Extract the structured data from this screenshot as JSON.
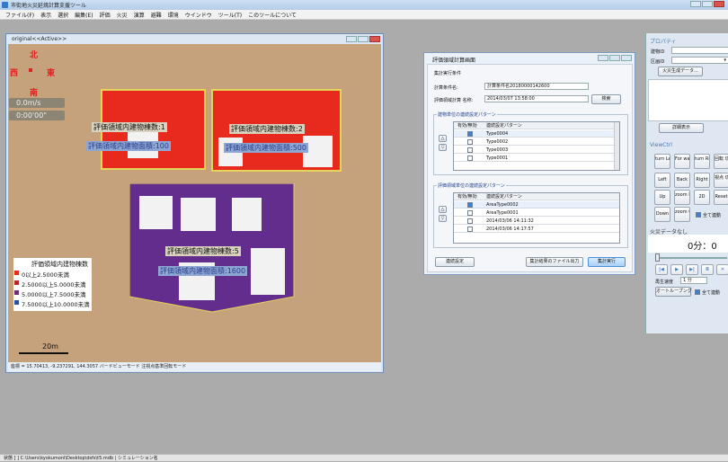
{
  "app": {
    "title": "市街地火災延焼計算支援ツール"
  },
  "menu": [
    "ファイル(F)",
    "表示",
    "選択",
    "編集(E)",
    "評価",
    "火災",
    "演算",
    "避難",
    "環境",
    "ウインドウ",
    "ツール(T)",
    "このツールについて"
  ],
  "original": {
    "title": "original<<Active>>",
    "hud": {
      "north": "北",
      "west": "西",
      "east": "東",
      "south": "南",
      "wind": "0.0m/s",
      "time": "0:00'00\""
    },
    "areas": [
      {
        "count_label": "評価領域内建物棟数:1",
        "area_label": "評価領域内建物面積:100"
      },
      {
        "count_label": "評価領域内建物棟数:2",
        "area_label": "評価領域内建物面積:500"
      },
      {
        "count_label": "評価領域内建物棟数:5",
        "area_label": "評価領域内建物面積:1600"
      }
    ],
    "legend": {
      "title": "評価領域内建物棟数",
      "items": [
        {
          "label": "0以上2.5000未満",
          "color": "#e82a1e"
        },
        {
          "label": "2.5000以上5.0000未満",
          "color": "#b8262b"
        },
        {
          "label": "5.0000以上7.5000未満",
          "color": "#6a2a7e"
        },
        {
          "label": "7.5000以上10.0000未満",
          "color": "#2453a6"
        }
      ]
    },
    "scale": "20m",
    "status": "座標 = 15.70413, -9.237291, 144.3057  バードビューモード  注視点基準回転モード"
  },
  "dialog": {
    "title": "評価領域計算画面",
    "section": "集計実行条件",
    "cond_label": "計算条件名:",
    "cond_value": "計算条件名20180000142600",
    "result_label": "評価領域計算 名称:",
    "result_value": "2014/03/07 13:58:00",
    "search_btn": "検索",
    "group1": {
      "title": "建物単位の連続設定パターン",
      "col1": "有効/無効",
      "col2": "連続設定パターン",
      "rows": [
        {
          "on": true,
          "name": "Type0004"
        },
        {
          "on": false,
          "name": "Type0002"
        },
        {
          "on": false,
          "name": "Type0003"
        },
        {
          "on": false,
          "name": "Type0001"
        }
      ]
    },
    "group2": {
      "title": "評価領域単位の連続設定パターン",
      "col1": "有効/無効",
      "col2": "連続設定パターン",
      "rows": [
        {
          "on": true,
          "name": "AreaType0002"
        },
        {
          "on": false,
          "name": "AreaType0001"
        },
        {
          "on": false,
          "name": "2014/03/06 14:11:32"
        },
        {
          "on": false,
          "name": "2014/03/06 14:17:57"
        }
      ]
    },
    "btn_detail": "連続設定",
    "btn_export": "集計結果のファイル出力",
    "btn_run": "集計実行"
  },
  "right": {
    "props_title": "プロパティ",
    "prop1": "建物ID",
    "prop2": "区画ID",
    "fire_btn": "火災生成データ...",
    "detail_btn": "詳細表示",
    "viewctrl_title": "ViewCtrl",
    "buttons": [
      "turn Left",
      "For ward",
      "turn Right",
      "回転 切替",
      "Left",
      "Back",
      "Right",
      "視点 切替",
      "Up",
      "zoom In",
      "2D",
      "Reset",
      "Down",
      "zoom Out"
    ],
    "check_all": "全て連動",
    "fire_title": "火災データなし",
    "time": "0分：0",
    "speed_label": "再生速度",
    "speed_value": "1 分",
    "loop": "オートループング",
    "check_all2": "全て連動"
  },
  "bottom": {
    "status": "状態 [                    ] C:\\Users\\kyokumoni\\Desktop\\dsfs\\t5.mdb  |  シミュレーション名"
  }
}
